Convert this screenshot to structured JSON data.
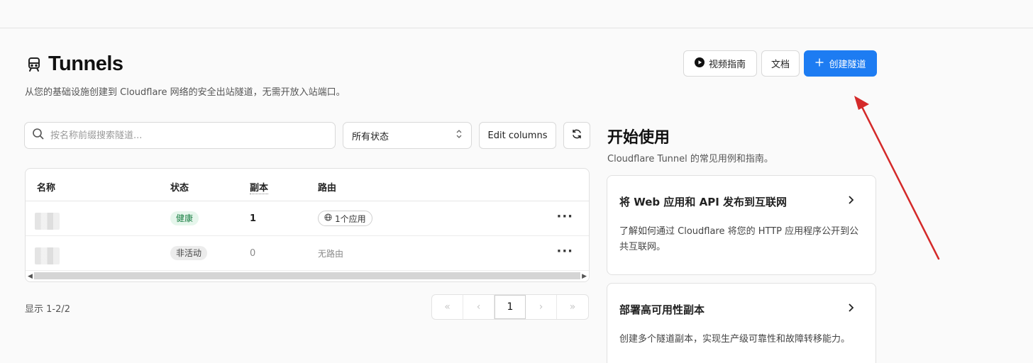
{
  "header": {
    "title": "Tunnels",
    "subtitle": "从您的基础设施创建到 Cloudflare 网络的安全出站隧道，无需开放入站端口。",
    "buttons": {
      "video_guide": "视频指南",
      "docs": "文档",
      "create_tunnel": "创建隧道"
    }
  },
  "toolbar": {
    "search_placeholder": "按名称前缀搜索隧道...",
    "status_filter": "所有状态",
    "edit_columns": "Edit columns"
  },
  "table": {
    "columns": [
      "名称",
      "状态",
      "副本",
      "路由"
    ],
    "rows": [
      {
        "status": "健康",
        "replicas": "1",
        "route": "1个应用",
        "more": "···"
      },
      {
        "status": "非活动",
        "replicas": "0",
        "route": "无路由",
        "more": "···"
      }
    ]
  },
  "pagination": {
    "showing": "显示 1-2/2",
    "current_page": "1"
  },
  "get_started": {
    "title": "开始使用",
    "subtitle": "Cloudflare Tunnel 的常见用例和指南。",
    "cards": [
      {
        "title": "将 Web 应用和 API 发布到互联网",
        "body": "了解如何通过 Cloudflare 将您的 HTTP 应用程序公开到公共互联网。"
      },
      {
        "title": "部署高可用性副本",
        "body": "创建多个隧道副本，实现生产级可靠性和故障转移能力。"
      }
    ]
  },
  "colors": {
    "primary": "#1d7cf2",
    "healthy_bg": "#e6f6ec",
    "healthy_text": "#1a7f43",
    "annotation_arrow": "#d42a2a"
  }
}
